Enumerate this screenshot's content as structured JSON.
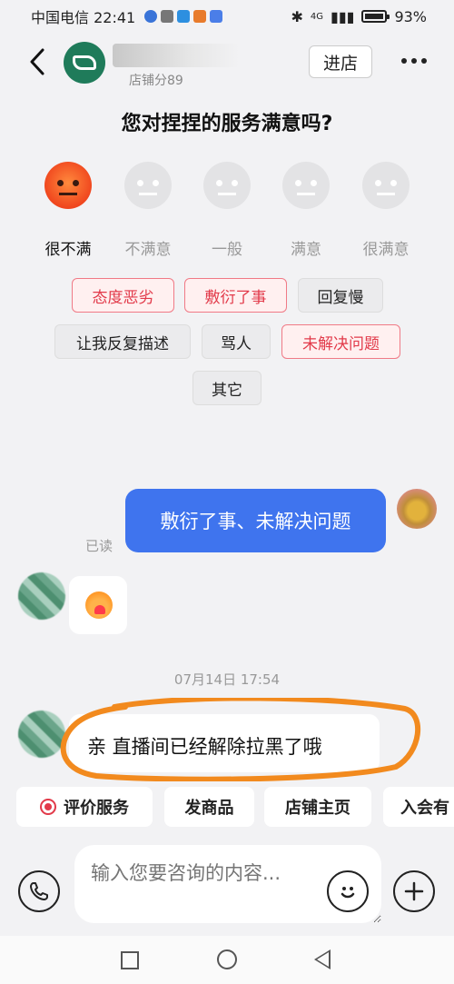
{
  "status_bar": {
    "carrier_time": "中国电信 22:41",
    "network": "4G",
    "battery": "93%"
  },
  "header": {
    "shop_score": "店铺分89",
    "enter_store": "进店"
  },
  "survey": {
    "title": "您对捏捏的服务满意吗?",
    "ratings": [
      {
        "label": "很不满",
        "active": true
      },
      {
        "label": "不满意",
        "active": false
      },
      {
        "label": "一般",
        "active": false
      },
      {
        "label": "满意",
        "active": false
      },
      {
        "label": "很满意",
        "active": false
      }
    ],
    "tags": [
      {
        "label": "态度恶劣",
        "selected": true
      },
      {
        "label": "敷衍了事",
        "selected": true
      },
      {
        "label": "回复慢",
        "selected": false
      },
      {
        "label": "让我反复描述",
        "selected": false
      },
      {
        "label": "骂人",
        "selected": false
      },
      {
        "label": "未解决问题",
        "selected": true
      },
      {
        "label": "其它",
        "selected": false
      }
    ]
  },
  "chat": {
    "outgoing_message": "敷衍了事、未解决问题",
    "read_status": "已读",
    "timestamp": "07月14日 17:54",
    "incoming_message": "亲 直播间已经解除拉黑了哦"
  },
  "quick_actions": [
    {
      "label": "评价服务",
      "icon": "heart-icon"
    },
    {
      "label": "发商品"
    },
    {
      "label": "店铺主页"
    },
    {
      "label": "入会有"
    }
  ],
  "input": {
    "placeholder": "输入您要咨询的内容..."
  },
  "colors": {
    "accent_blue": "#3f74ee",
    "tag_red": "#e23a4a",
    "highlight_orange": "#f28a1e"
  }
}
